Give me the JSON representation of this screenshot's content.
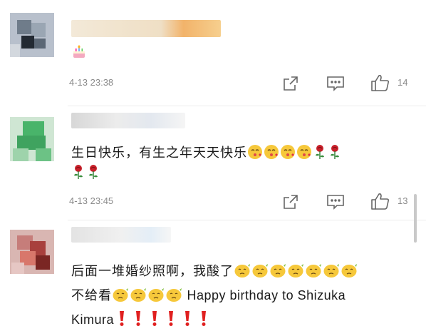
{
  "colors": {
    "background": "#ffffff",
    "meta_text": "#8a8a8a",
    "icon": "#666666",
    "rose": "#c8202a",
    "exclamation": "#e02020",
    "emoji_yellow": "#f6c83b"
  },
  "comments": [
    {
      "text_lines": [
        {
          "segments": [
            {
              "emoji": "cake-emoji"
            }
          ]
        }
      ],
      "time": "4-13 23:38",
      "like_count": "14"
    },
    {
      "text_lines": [
        {
          "segments": [
            {
              "text": "生日快乐，有生之年天天快乐"
            },
            {
              "emoji": "kiss-face-emoji"
            },
            {
              "emoji": "kiss-face-emoji"
            },
            {
              "emoji": "kiss-face-emoji"
            },
            {
              "emoji": "kiss-face-emoji"
            },
            {
              "emoji": "rose-emoji"
            },
            {
              "emoji": "rose-emoji"
            }
          ]
        },
        {
          "segments": [
            {
              "emoji": "rose-emoji"
            },
            {
              "emoji": "rose-emoji"
            }
          ]
        }
      ],
      "time": "4-13 23:45",
      "like_count": "13"
    },
    {
      "text_lines": [
        {
          "segments": [
            {
              "text": "后面一堆婚纱照啊，我酸了"
            },
            {
              "emoji": "lemon-face-emoji"
            },
            {
              "emoji": "lemon-face-emoji"
            },
            {
              "emoji": "lemon-face-emoji"
            },
            {
              "emoji": "lemon-face-emoji"
            },
            {
              "emoji": "lemon-face-emoji"
            },
            {
              "emoji": "lemon-face-emoji"
            },
            {
              "emoji": "lemon-face-emoji"
            }
          ]
        },
        {
          "segments": [
            {
              "text": "不给看"
            },
            {
              "emoji": "lemon-face-emoji"
            },
            {
              "emoji": "lemon-face-emoji"
            },
            {
              "emoji": "lemon-face-emoji"
            },
            {
              "emoji": "lemon-face-emoji"
            },
            {
              "text": " Happy birthday to Shizuka",
              "latin": true
            }
          ]
        },
        {
          "segments": [
            {
              "text": "Kimura",
              "latin": true
            },
            {
              "emoji": "exclamation-emoji"
            },
            {
              "emoji": "exclamation-emoji"
            },
            {
              "emoji": "exclamation-emoji"
            },
            {
              "emoji": "exclamation-emoji"
            },
            {
              "emoji": "exclamation-emoji"
            },
            {
              "emoji": "exclamation-emoji"
            }
          ]
        }
      ]
    }
  ],
  "icons": {
    "share": "share-icon",
    "comment": "comment-icon",
    "like": "thumbs-up-icon"
  }
}
